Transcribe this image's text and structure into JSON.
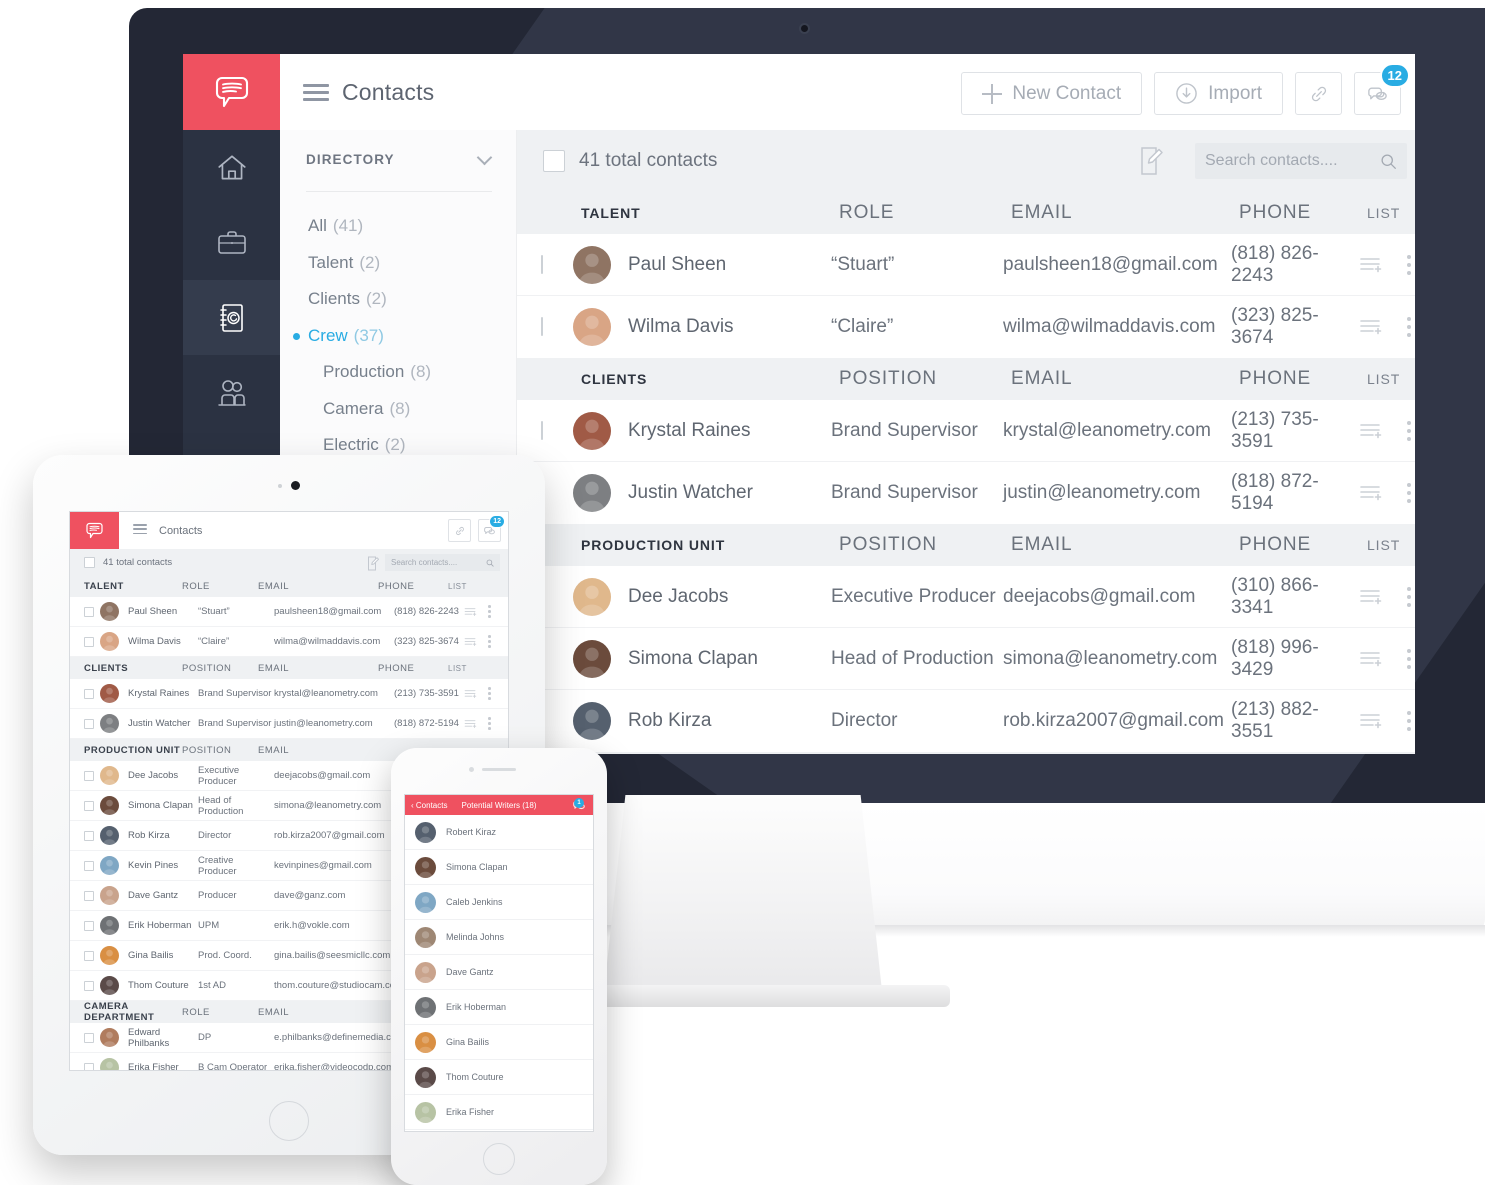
{
  "app": {
    "logo_icon": "chat-bubble-logo",
    "title": "Contacts",
    "menu_icon": "hamburger-menu-icon",
    "accent_red": "#ef5160",
    "accent_blue": "#29ace3",
    "nav_dark": "#2b3242"
  },
  "toolbar": {
    "new_contact_label": "New Contact",
    "new_contact_icon": "plus-icon",
    "import_label": "Import",
    "import_icon": "download-circle-icon",
    "link_icon": "link-icon",
    "messages_icon": "chat-bubbles-icon",
    "messages_badge": "12"
  },
  "leftnav": {
    "items": [
      {
        "name": "home",
        "icon": "home-icon",
        "active": false
      },
      {
        "name": "projects",
        "icon": "briefcase-icon",
        "active": false
      },
      {
        "name": "contacts",
        "icon": "address-book-icon",
        "active": true
      },
      {
        "name": "team",
        "icon": "people-icon",
        "active": false
      }
    ]
  },
  "directory": {
    "header": "DIRECTORY",
    "collapse_icon": "chevron-down-icon",
    "items": [
      {
        "label": "All",
        "count": "(41)",
        "sub": false,
        "selected": false
      },
      {
        "label": "Talent",
        "count": "(2)",
        "sub": false,
        "selected": false
      },
      {
        "label": "Clients",
        "count": "(2)",
        "sub": false,
        "selected": false
      },
      {
        "label": "Crew",
        "count": "(37)",
        "sub": false,
        "selected": true
      },
      {
        "label": "Production",
        "count": "(8)",
        "sub": true,
        "selected": false
      },
      {
        "label": "Camera",
        "count": "(8)",
        "sub": true,
        "selected": false
      },
      {
        "label": "Electric",
        "count": "(2)",
        "sub": true,
        "selected": false
      }
    ]
  },
  "content": {
    "total_label": "41 total contacts",
    "compose_icon": "compose-note-icon",
    "search_placeholder": "Search contacts....",
    "search_icon": "search-icon",
    "list_icon": "add-to-list-icon",
    "more_icon": "more-vertical-icon"
  },
  "sections": [
    {
      "key": "TALENT",
      "columns": [
        "ROLE",
        "EMAIL",
        "PHONE",
        "LIST"
      ],
      "rows": [
        {
          "name": "Paul Sheen",
          "role": "“Stuart”",
          "email": "paulsheen18@gmail.com",
          "phone": "(818) 826-2243",
          "avatar": "#8f7463"
        },
        {
          "name": "Wilma Davis",
          "role": "“Claire”",
          "email": "wilma@wilmaddavis.com",
          "phone": "(323) 825-3674",
          "avatar": "#d9a585"
        }
      ]
    },
    {
      "key": "CLIENTS",
      "columns": [
        "POSITION",
        "EMAIL",
        "PHONE",
        "LIST"
      ],
      "rows": [
        {
          "name": "Krystal Raines",
          "role": "Brand Supervisor",
          "email": "krystal@leanometry.com",
          "phone": "(213) 735-3591",
          "avatar": "#a05a46"
        },
        {
          "name": "Justin Watcher",
          "role": "Brand Supervisor",
          "email": "justin@leanometry.com",
          "phone": "(818) 872-5194",
          "avatar": "#7d7f82"
        }
      ]
    },
    {
      "key": "PRODUCTION UNIT",
      "columns": [
        "POSITION",
        "EMAIL",
        "PHONE",
        "LIST"
      ],
      "rows": [
        {
          "name": "Dee Jacobs",
          "role": "Executive Producer",
          "email": "deejacobs@gmail.com",
          "phone": "(310) 866-3341",
          "avatar": "#e0b88c"
        },
        {
          "name": "Simona Clapan",
          "role": "Head of Production",
          "email": "simona@leanometry.com",
          "phone": "(818) 996-3429",
          "avatar": "#6b4b3c"
        },
        {
          "name": "Rob Kirza",
          "role": "Director",
          "email": "rob.kirza2007@gmail.com",
          "phone": "(213) 882-3551",
          "avatar": "#55606e"
        }
      ]
    }
  ],
  "tablet": {
    "title": "Contacts",
    "total_label": "41 total contacts",
    "search_placeholder": "Search contacts....",
    "messages_badge": "12",
    "sections": [
      {
        "key": "TALENT",
        "columns": [
          "ROLE",
          "EMAIL",
          "PHONE",
          "LIST"
        ],
        "rows": [
          {
            "name": "Paul Sheen",
            "role": "“Stuart”",
            "email": "paulsheen18@gmail.com",
            "phone": "(818) 826-2243",
            "avatar": "#8f7463"
          },
          {
            "name": "Wilma Davis",
            "role": "“Claire”",
            "email": "wilma@wilmaddavis.com",
            "phone": "(323) 825-3674",
            "avatar": "#d9a585"
          }
        ]
      },
      {
        "key": "CLIENTS",
        "columns": [
          "POSITION",
          "EMAIL",
          "PHONE",
          "LIST"
        ],
        "rows": [
          {
            "name": "Krystal Raines",
            "role": "Brand Supervisor",
            "email": "krystal@leanometry.com",
            "phone": "(213) 735-3591",
            "avatar": "#a05a46"
          },
          {
            "name": "Justin Watcher",
            "role": "Brand Supervisor",
            "email": "justin@leanometry.com",
            "phone": "(818) 872-5194",
            "avatar": "#7d7f82"
          }
        ]
      },
      {
        "key": "PRODUCTION UNIT",
        "columns": [
          "POSITION",
          "EMAIL",
          "",
          ""
        ],
        "rows": [
          {
            "name": "Dee Jacobs",
            "role": "Executive Producer",
            "email": "deejacobs@gmail.com",
            "phone": "",
            "avatar": "#e0b88c"
          },
          {
            "name": "Simona Clapan",
            "role": "Head of Production",
            "email": "simona@leanometry.com",
            "phone": "",
            "avatar": "#6b4b3c"
          },
          {
            "name": "Rob Kirza",
            "role": "Director",
            "email": "rob.kirza2007@gmail.com",
            "phone": "",
            "avatar": "#55606e"
          },
          {
            "name": "Kevin Pines",
            "role": "Creative Producer",
            "email": "kevinpines@gmail.com",
            "phone": "",
            "avatar": "#7fa7c4"
          },
          {
            "name": "Dave Gantz",
            "role": "Producer",
            "email": "dave@ganz.com",
            "phone": "",
            "avatar": "#c9a38c"
          },
          {
            "name": "Erik Hoberman",
            "role": "UPM",
            "email": "erik.h@vokle.com",
            "phone": "",
            "avatar": "#6e7174"
          },
          {
            "name": "Gina Bailis",
            "role": "Prod. Coord.",
            "email": "gina.bailis@seesmicllc.com",
            "phone": "",
            "avatar": "#d98f43"
          },
          {
            "name": "Thom Couture",
            "role": "1st AD",
            "email": "thom.couture@studiocam.com",
            "phone": "",
            "avatar": "#5a4a48"
          }
        ]
      },
      {
        "key": "CAMERA DEPARTMENT",
        "columns": [
          "ROLE",
          "EMAIL",
          "",
          ""
        ],
        "rows": [
          {
            "name": "Edward Philbanks",
            "role": "DP",
            "email": "e.philbanks@definemedia.com",
            "phone": "",
            "avatar": "#b07c5e"
          },
          {
            "name": "Erika Fisher",
            "role": "B Cam Operator",
            "email": "erika.fisher@videocodp.com",
            "phone": "",
            "avatar": "#b7c3a4"
          }
        ]
      }
    ]
  },
  "phone": {
    "back_label": "‹ Contacts",
    "title": "Potential Writers (18)",
    "messages_badge": "1",
    "rows": [
      {
        "name": "Robert Kiraz",
        "avatar": "#55606e"
      },
      {
        "name": "Simona Clapan",
        "avatar": "#6b4b3c"
      },
      {
        "name": "Caleb Jenkins",
        "avatar": "#7fa7c4"
      },
      {
        "name": "Melinda Johns",
        "avatar": "#9e8774"
      },
      {
        "name": "Dave Gantz",
        "avatar": "#c9a38c"
      },
      {
        "name": "Erik Hoberman",
        "avatar": "#6e7174"
      },
      {
        "name": "Gina Bailis",
        "avatar": "#d98f43"
      },
      {
        "name": "Thom Couture",
        "avatar": "#5a4a48"
      },
      {
        "name": "Erika Fisher",
        "avatar": "#b7c3a4"
      }
    ]
  }
}
